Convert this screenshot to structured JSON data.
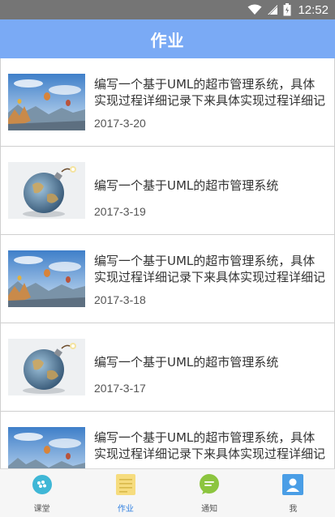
{
  "status_bar": {
    "time": "12:52"
  },
  "app_bar": {
    "title": "作业"
  },
  "assignments": [
    {
      "title": "编写一个基于UML的超市管理系统，具体实现过程详细记录下来具体实现过程详细记录下来",
      "date": "2017-3-20",
      "image": "balloon-landscape"
    },
    {
      "title": "编写一个基于UML的超市管理系统",
      "date": "2017-3-19",
      "image": "earth-bomb"
    },
    {
      "title": "编写一个基于UML的超市管理系统，具体实现过程详细记录下来具体实现过程详细记录下来",
      "date": "2017-3-18",
      "image": "balloon-landscape"
    },
    {
      "title": "编写一个基于UML的超市管理系统",
      "date": "2017-3-17",
      "image": "earth-bomb"
    },
    {
      "title": "编写一个基于UML的超市管理系统，具体实现过程详细记录下来具体实现过程详细记录下来",
      "date": "",
      "image": "balloon-landscape"
    }
  ],
  "tabs": [
    {
      "label": "课堂",
      "icon": "classroom-icon",
      "active": false
    },
    {
      "label": "作业",
      "icon": "homework-icon",
      "active": true
    },
    {
      "label": "通知",
      "icon": "notification-icon",
      "active": false
    },
    {
      "label": "我",
      "icon": "profile-icon",
      "active": false
    }
  ],
  "colors": {
    "app_bar": "#7aaaf5",
    "status_bar": "#757575",
    "active_tab": "#2f7fe0"
  }
}
